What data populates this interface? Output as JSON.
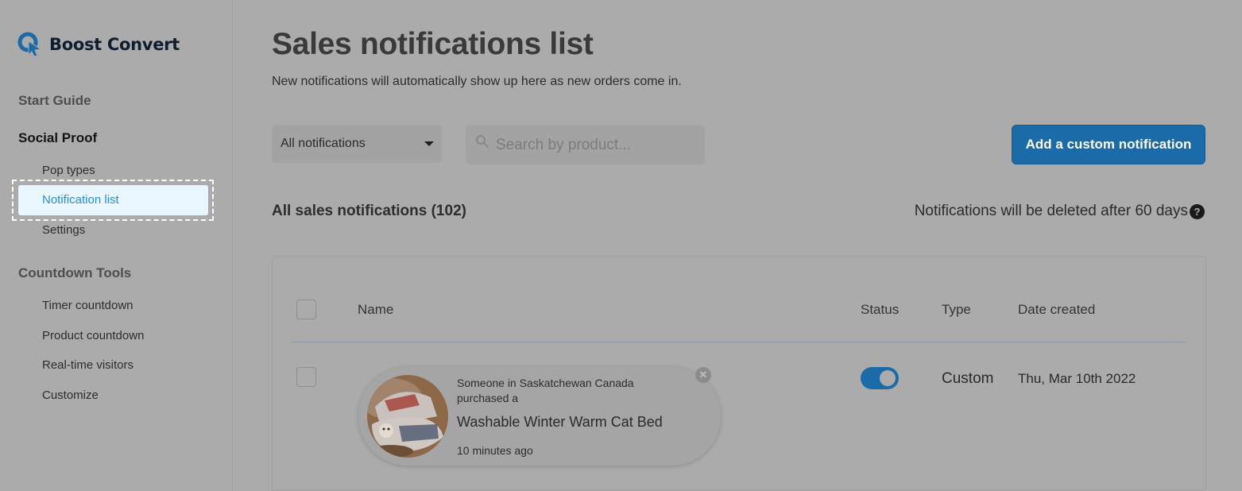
{
  "brand": {
    "name": "Boost Convert",
    "logo_icon": "boost-convert-logo"
  },
  "sidebar": {
    "sections": [
      {
        "label": "Start Guide"
      },
      {
        "label": "Social Proof",
        "items": [
          "Pop types",
          "Notification list",
          "Settings"
        ]
      },
      {
        "label": "Countdown Tools",
        "items": [
          "Timer countdown",
          "Product countdown",
          "Real-time visitors",
          "Customize"
        ]
      }
    ],
    "active_item": "Notification list"
  },
  "page": {
    "title": "Sales notifications list",
    "subtitle": "New notifications will automatically show up here as new orders come in."
  },
  "toolbar": {
    "filter_selected": "All notifications",
    "search_placeholder": "Search by product...",
    "add_button_label": "Add a custom notification"
  },
  "list": {
    "heading": "All sales notifications (102)",
    "retention_note": "Notifications will be deleted after 60 days",
    "columns": {
      "name": "Name",
      "status": "Status",
      "type": "Type",
      "date": "Date created"
    },
    "rows": [
      {
        "preview": {
          "line1": "Someone in Saskatchewan Canada",
          "line2": "purchased a",
          "product": "Washable Winter Warm Cat Bed",
          "time": "10 minutes ago"
        },
        "status_on": true,
        "type": "Custom",
        "date": "Thu, Mar 10th 2022"
      }
    ]
  },
  "colors": {
    "accent": "#1b6ba9",
    "active_link": "#2a8ddc",
    "overlay_bg": "#ababab"
  }
}
